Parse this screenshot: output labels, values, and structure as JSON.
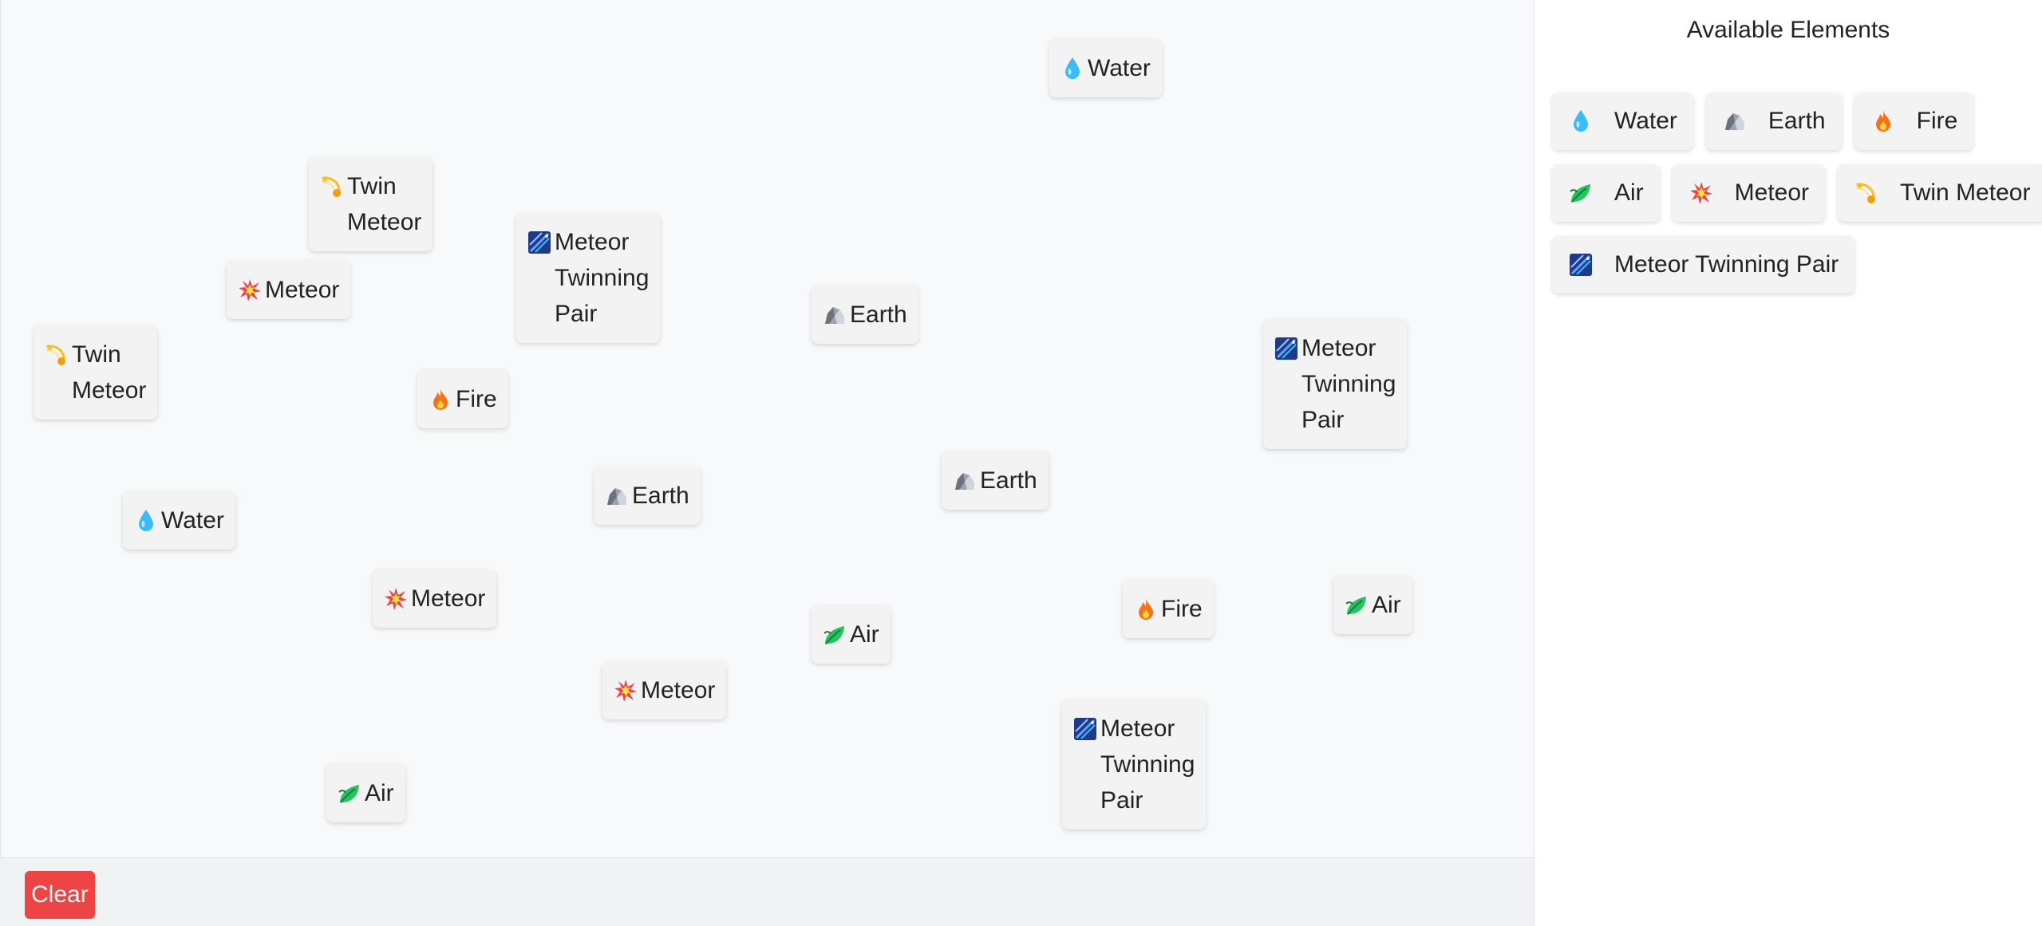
{
  "sidebar": {
    "title": "Available Elements",
    "rows": [
      [
        {
          "label": "Water",
          "icon": "water-icon"
        },
        {
          "label": "Earth",
          "icon": "earth-icon"
        },
        {
          "label": "Fire",
          "icon": "fire-icon"
        }
      ],
      [
        {
          "label": "Air",
          "icon": "air-icon"
        },
        {
          "label": "Meteor",
          "icon": "meteor-icon"
        },
        {
          "label": "Twin Meteor",
          "icon": "twin-meteor-icon"
        }
      ],
      [
        {
          "label": "Meteor Twinning Pair",
          "icon": "meteor-twinning-pair-icon"
        }
      ]
    ]
  },
  "workspace": {
    "nodes": [
      {
        "label": "Water",
        "icon": "water-icon"
      },
      {
        "label": "Twin\nMeteor",
        "icon": "twin-meteor-icon"
      },
      {
        "label": "Meteor\nTwinning\nPair",
        "icon": "meteor-twinning-pair-icon"
      },
      {
        "label": "Meteor",
        "icon": "meteor-icon"
      },
      {
        "label": "Earth",
        "icon": "earth-icon"
      },
      {
        "label": "Twin\nMeteor",
        "icon": "twin-meteor-icon"
      },
      {
        "label": "Meteor\nTwinning\nPair",
        "icon": "meteor-twinning-pair-icon"
      },
      {
        "label": "Fire",
        "icon": "fire-icon"
      },
      {
        "label": "Earth",
        "icon": "earth-icon"
      },
      {
        "label": "Earth",
        "icon": "earth-icon"
      },
      {
        "label": "Water",
        "icon": "water-icon"
      },
      {
        "label": "Meteor",
        "icon": "meteor-icon"
      },
      {
        "label": "Fire",
        "icon": "fire-icon"
      },
      {
        "label": "Air",
        "icon": "air-icon"
      },
      {
        "label": "Air",
        "icon": "air-icon"
      },
      {
        "label": "Meteor",
        "icon": "meteor-icon"
      },
      {
        "label": "Meteor\nTwinning\nPair",
        "icon": "meteor-twinning-pair-icon"
      },
      {
        "label": "Air",
        "icon": "air-icon"
      }
    ]
  },
  "toolbar": {
    "clear_label": "Clear"
  },
  "colors": {
    "clear_button": "#ef4444",
    "canvas_bg": "#f8f9fa",
    "chip_bg": "#f3f3f4",
    "water": "#38bdf8",
    "fire": "#f97316",
    "air": "#16a34a",
    "earth": "#9ca3af",
    "meteor": "#ef4444",
    "twin_meteor": "#fbbf24",
    "twinning_pair": "#1e3a8a"
  }
}
